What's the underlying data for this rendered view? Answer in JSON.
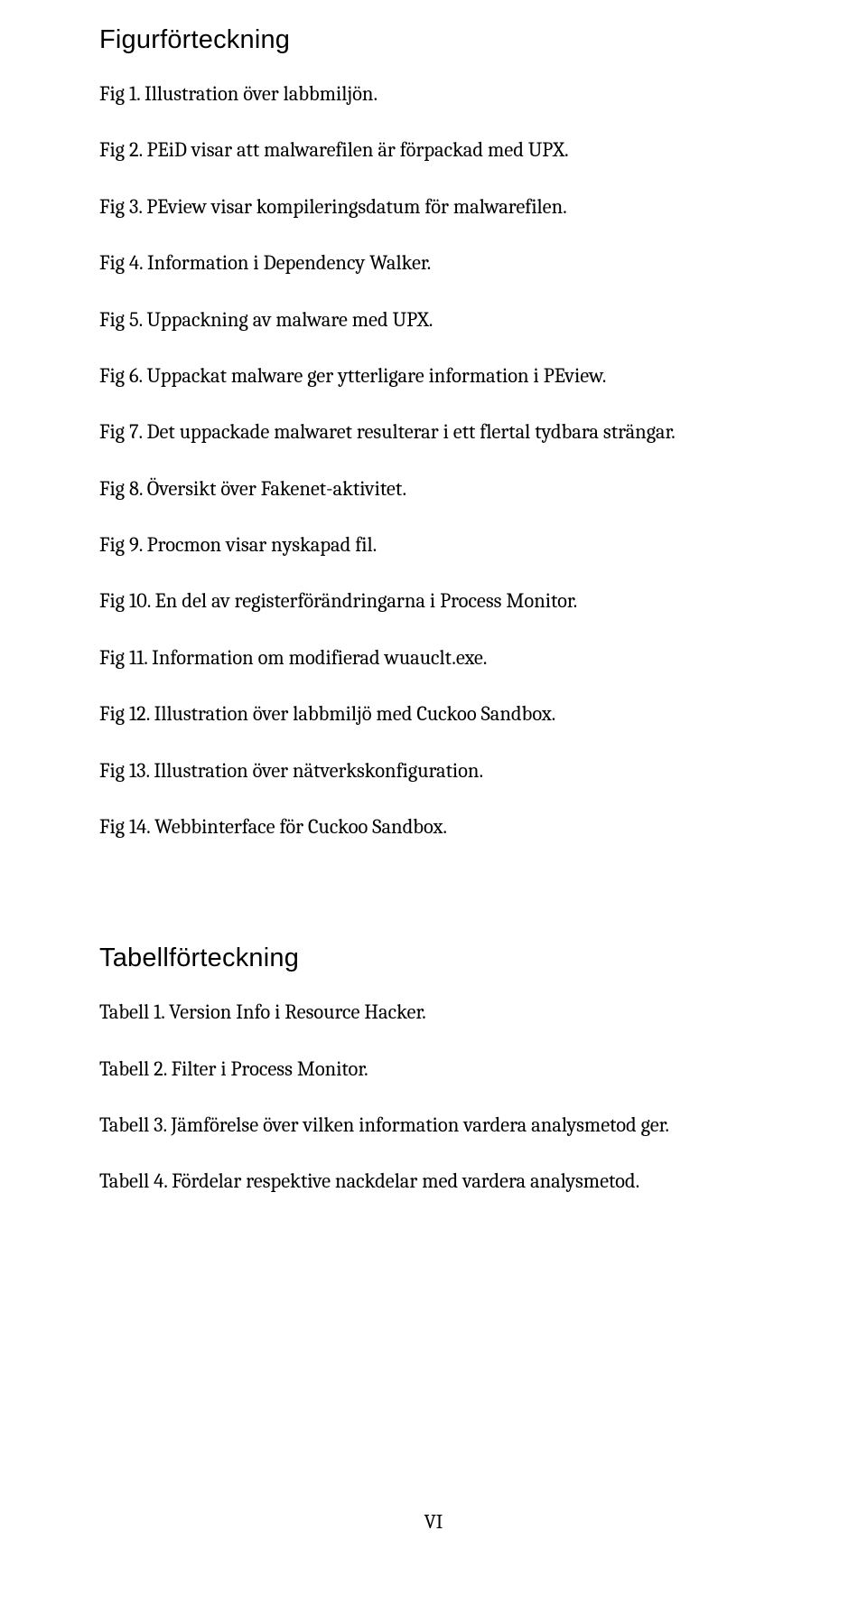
{
  "sections": {
    "figures": {
      "heading": "Figurförteckning",
      "items": [
        "Fig 1. Illustration över labbmiljön.",
        "Fig 2. PEiD visar att malwarefilen är förpackad med UPX.",
        "Fig 3. PEview visar kompileringsdatum för malwarefilen.",
        "Fig 4. Information i Dependency Walker.",
        "Fig 5. Uppackning av malware med UPX.",
        "Fig 6. Uppackat malware ger ytterligare information i PEview.",
        "Fig 7. Det uppackade malwaret resulterar i ett flertal tydbara strängar.",
        "Fig 8. Översikt över Fakenet-aktivitet.",
        "Fig 9. Procmon visar nyskapad fil.",
        "Fig 10. En del av registerförändringarna i Process Monitor.",
        "Fig 11. Information om modifierad wuauclt.exe.",
        "Fig 12. Illustration över labbmiljö med Cuckoo Sandbox.",
        "Fig 13. Illustration över nätverkskonfiguration.",
        "Fig 14. Webbinterface för Cuckoo Sandbox."
      ]
    },
    "tables": {
      "heading": "Tabellförteckning",
      "items": [
        "Tabell 1. Version Info i Resource Hacker.",
        "Tabell 2. Filter i Process Monitor.",
        "Tabell 3. Jämförelse över vilken information vardera analysmetod ger.",
        "Tabell 4. Fördelar respektive nackdelar med vardera analysmetod."
      ]
    }
  },
  "page_number": "VI"
}
